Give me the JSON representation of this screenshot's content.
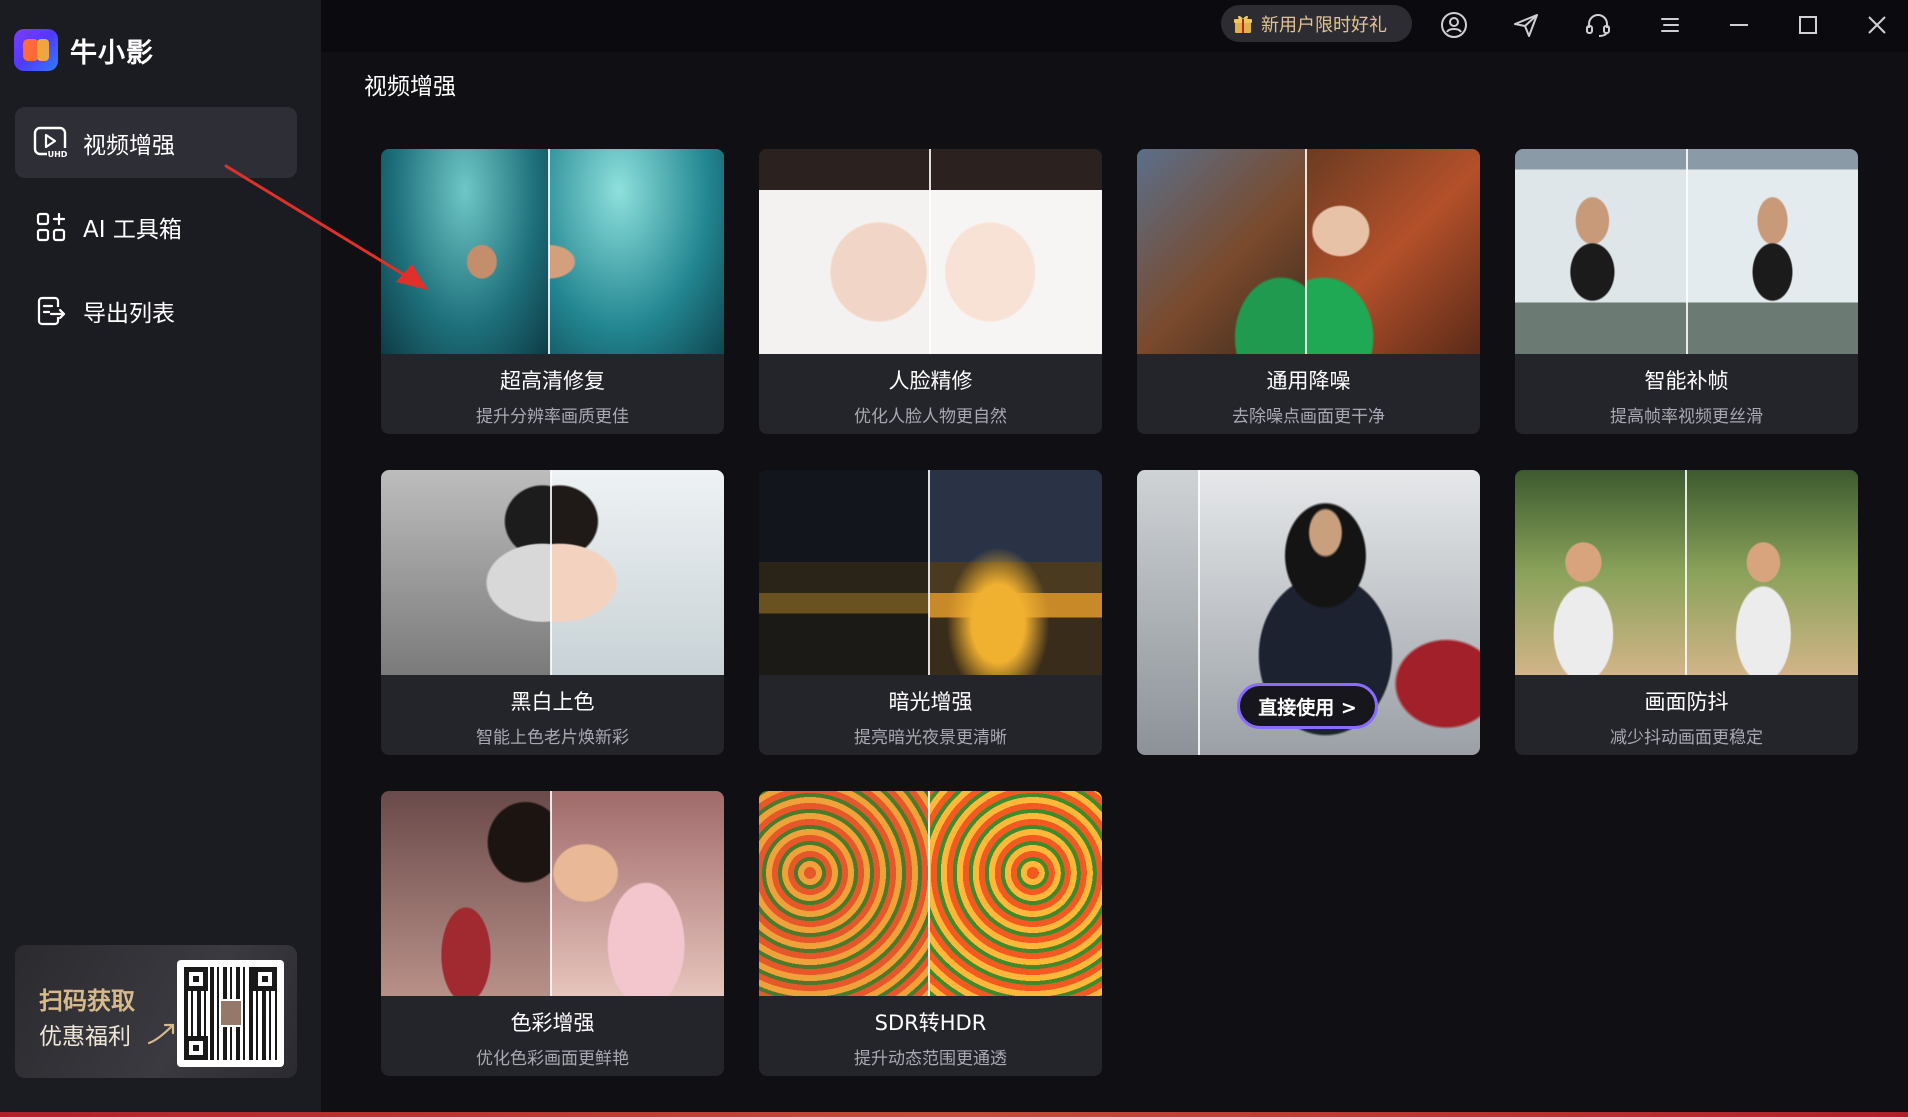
{
  "app": {
    "name": "牛小影"
  },
  "sidebar": {
    "items": [
      {
        "label": "视频增强",
        "active": true,
        "icon": "uhd-video-icon",
        "badge": "UHD"
      },
      {
        "label": "AI 工具箱",
        "active": false,
        "icon": "toolbox-grid-icon"
      },
      {
        "label": "导出列表",
        "active": false,
        "icon": "export-list-icon"
      }
    ],
    "promo": {
      "line1": "扫码获取",
      "line2": "优惠福利"
    }
  },
  "topbar": {
    "gift_label": "新用户限时好礼",
    "icons": [
      "user-icon",
      "send-icon",
      "headset-icon",
      "menu-icon",
      "minimize-icon",
      "maximize-icon",
      "close-icon"
    ]
  },
  "main": {
    "title": "视频增强",
    "cards": [
      {
        "title": "超高清修复",
        "subtitle": "提升分辨率画质更佳"
      },
      {
        "title": "人脸精修",
        "subtitle": "优化人脸人物更自然"
      },
      {
        "title": "通用降噪",
        "subtitle": "去除噪点画面更干净"
      },
      {
        "title": "智能补帧",
        "subtitle": "提高帧率视频更丝滑"
      },
      {
        "title": "黑白上色",
        "subtitle": "智能上色老片焕新彩"
      },
      {
        "title": "暗光增强",
        "subtitle": "提亮暗光夜景更清晰"
      },
      {
        "title": "",
        "subtitle": "",
        "hover_button": "直接使用 >"
      },
      {
        "title": "画面防抖",
        "subtitle": "减少抖动画面更稳定"
      },
      {
        "title": "色彩增强",
        "subtitle": "优化色彩画面更鲜艳"
      },
      {
        "title": "SDR转HDR",
        "subtitle": "提升动态范围更通透"
      }
    ]
  },
  "colors": {
    "accent": "#8a6bff",
    "gift_text": "#e2c48f",
    "sidebar_bg": "#1b1b22",
    "card_bg": "#24242b"
  }
}
